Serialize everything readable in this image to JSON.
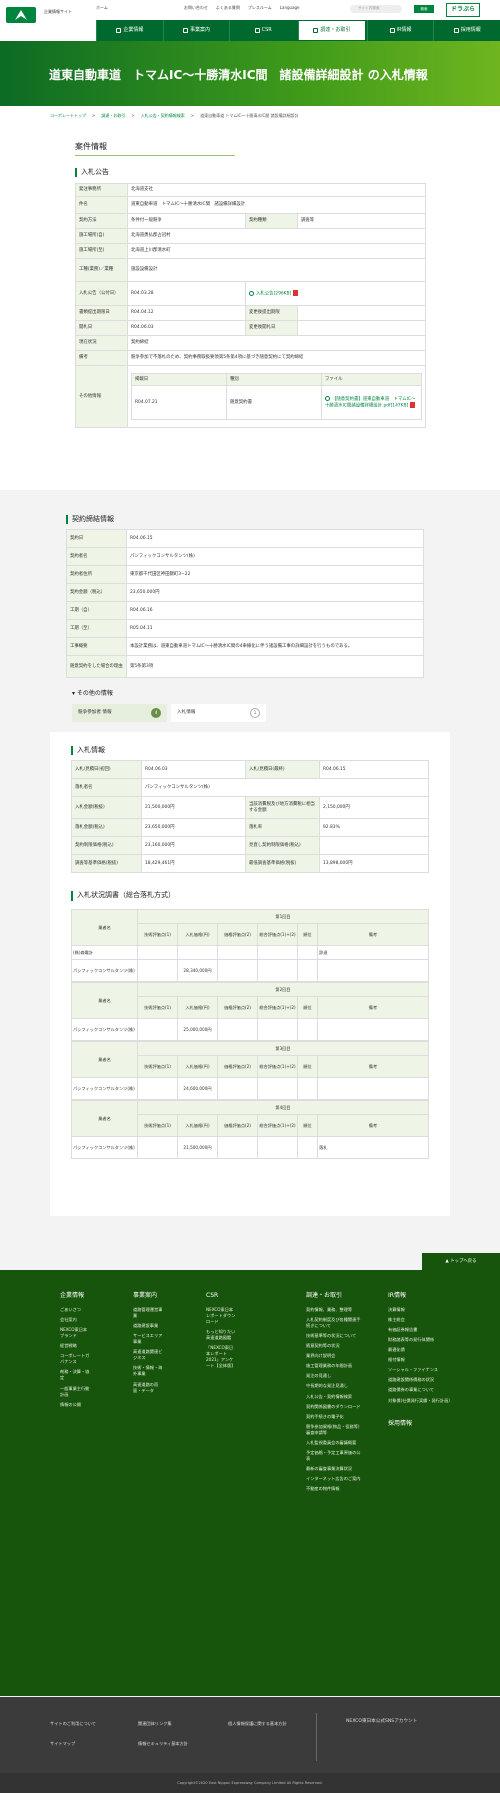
{
  "header": {
    "corp_name": "企業情報サイト",
    "home": "ホーム",
    "contact": "お問い合わせ",
    "faq": "よくある質問",
    "press": "プレスルーム",
    "lang": "Language",
    "search_placeholder": "サイト内検索",
    "search_btn": "検索",
    "drapla": "ドラぷら"
  },
  "nav": [
    "企業情報",
    "事業案内",
    "CSR",
    "調達・お取引",
    "IR情報",
    "採用情報"
  ],
  "title": "道東自動車道　トマムIC〜十勝清水IC間　諸設備詳細設計 の入札情報",
  "breadcrumb": [
    "コーポレートトップ",
    "調達・お取引",
    "入札公告・契約情報検索",
    "道東自動車道 トマムIC〜十勝清水IC間 諸設備詳細設計"
  ],
  "case": {
    "heading": "案件情報",
    "koukoku": "入札公告",
    "rows": [
      [
        "発注事務所",
        "北海道支社"
      ],
      [
        "件名",
        "道東自動車道　トマムIC〜十勝清水IC間　諸設備詳細設計"
      ]
    ],
    "method_l": "契約方法",
    "method": "条件付一般競争",
    "kind_l": "契約種類",
    "kind": "調査等",
    "place1_l": "施工場所(自)",
    "place1": "北海道勇払郡占冠村",
    "place2_l": "施工場所(至)",
    "place2": "北海道上川郡清水町",
    "type_l": "工種(業務)／業種",
    "type": "施設設備設計",
    "date_l": "入札公告（公付日）",
    "date": "R04.03.28",
    "file": "入札公告[296KB]",
    "desk_l": "書類提出期限日",
    "desk": "R04.04.12",
    "chg1_l": "変更後提出期限",
    "chg1": "",
    "open_l": "開札日",
    "open": "R04.06.03",
    "chg2_l": "変更後開札日",
    "chg2": "",
    "status_l": "現在状況",
    "status": "契約締結",
    "note_l": "備考",
    "note": "競争参加で不落札のため、契約事務取扱要領第5条第4項に基づき随意契約にて契約締結",
    "other_l": "その他情報",
    "oh": [
      "掲載日",
      "種別",
      "ファイル"
    ],
    "od": "R04.07.21",
    "ok": "随意契約書",
    "of": "【随意契約書】道東自動車道　トマムIC〜十勝清水IC間諸設備詳細設計.pdf[147KB]"
  },
  "contract": {
    "heading": "契約締結情報",
    "rows": [
      [
        "契約日",
        "R04.06.15"
      ],
      [
        "契約者名",
        "パシフィックコンサルタンツ(株)"
      ],
      [
        "契約者住所",
        "東京都千代田区神田錦町3−22"
      ],
      [
        "契約金額（税込）",
        "23,650,000円"
      ],
      [
        "工期（自）",
        "R04.06.16"
      ],
      [
        "工期（至）",
        "R05.04.11"
      ],
      [
        "工事概要",
        "本設計業務は、道東自動車道トマムIC〜十勝清水IC間の4車線化に伴う諸設備工事の詳細設計を行うものである。"
      ],
      [
        "随意契約をした場合の理由",
        "第5条第3項"
      ]
    ]
  },
  "other": {
    "heading": "その他の情報",
    "tab1": "競争参加者 情報",
    "tab1_n": "4",
    "tab2": "入札情報",
    "tab2_n": "1"
  },
  "bid": {
    "heading": "入札情報",
    "rows": [
      [
        "入札/見積日(初回)",
        "R04.06.03",
        "入札/見積日(最終)",
        "R04.06.15"
      ],
      [
        "落札者名",
        "パシフィックコンサルタンツ(株)",
        "",
        ""
      ],
      [
        "入札金額(税抜)",
        "21,500,000円",
        "当該消費税及び地方消費税に相当する金額",
        "2,150,000円"
      ],
      [
        "落札金額(税込)",
        "23,650,000円",
        "落札率",
        "92.83%"
      ],
      [
        "契約制限価格(税込)",
        "23,160,000円",
        "見直し契約制限価格(税込)",
        ""
      ],
      [
        "調査等基準価格(税抜)",
        "18,429,461円",
        "最低調査基準価格(税抜)",
        "13,898,000円"
      ]
    ]
  },
  "status": {
    "heading": "入札状況調書（総合落札方式）",
    "name_h": "業者名",
    "cols": [
      "技術評価点(1)",
      "入札価格(円)",
      "価格評価点(2)",
      "総合評価点(1)+(2)",
      "順位",
      "備考"
    ],
    "rounds": [
      {
        "label": "第1回目",
        "rows": [
          [
            "(株)森電計",
            "",
            "",
            "",
            "",
            "",
            "辞退"
          ],
          [
            "パシフィックコンサルタンツ(株)",
            "",
            "28,340,000円",
            "",
            "",
            "",
            ""
          ]
        ]
      },
      {
        "label": "第2回目",
        "rows": [
          [
            "パシフィックコンサルタンツ(株)",
            "",
            "25,000,000円",
            "",
            "",
            "",
            ""
          ]
        ]
      },
      {
        "label": "第3回目",
        "rows": [
          [
            "パシフィックコンサルタンツ(株)",
            "",
            "24,600,000円",
            "",
            "",
            "",
            ""
          ]
        ]
      },
      {
        "label": "第4回目",
        "rows": [
          [
            "パシフィックコンサルタンツ(株)",
            "",
            "21,500,000円",
            "",
            "",
            "",
            "落札"
          ]
        ]
      }
    ]
  },
  "totop": "トップへ戻る",
  "footer": {
    "cols": [
      {
        "h": "企業情報",
        "items": [
          "ごあいさつ",
          "会社案内",
          "NEXCO東日本ブランド",
          "経営戦略",
          "コーポレートガバナンス",
          "剤務・決算・協定",
          "一般事業主行動計画",
          "情報の公開"
        ]
      },
      {
        "h": "事業案内",
        "items": [
          "道路管理運営事業",
          "道路建設事業",
          "サービスエリア事業",
          "高速道路関連ビジネス",
          "技術・情報・海外事業",
          "高速道路の而面・データ"
        ]
      },
      {
        "h": "CSR",
        "items": [
          "NEXCO東日本レポートダウンロード",
          "もっと知りたい高速道路図鑑",
          "「NEXCO東日本レポート2021」アンケート【全体版】"
        ]
      },
      {
        "h": "調達・お取引",
        "items": [
          "契約情報、業務、整理等",
          "入札契約制度及び各種関連手続きについて",
          "技術基準等の状況について",
          "随意契約等の状況",
          "業界向け説明会",
          "施工管理業務の年間計画",
          "発注の見通し",
          "中長期的な発注見通し",
          "入札公告・契約情報検索",
          "契約関係図書のダウンロード",
          "契約手続きの電子化",
          "競争参加資格(物品・役務等)審査申請等",
          "入札監視委員会の審議概要",
          "予定価格・予定工事原価の公表",
          "最新の審査事業決算状況",
          "インターネット広告のご案内",
          "不動産の物件情報"
        ]
      },
      {
        "h": "IR情報",
        "items": [
          "決算情報",
          "株主総会",
          "有価証券報告書",
          "財務諸表等の発行体関係",
          "最適化債",
          "格付情報",
          "ソーシャル・ファイナンス",
          "道路建設関係債務の状況",
          "道路債券の事業について",
          "対象債(社債発行実績・発行計画)"
        ]
      },
      {
        "h": "採用情報",
        "items": []
      }
    ]
  },
  "footer2": {
    "l1": "サイトのご利用について",
    "l2": "関連団体リンク集",
    "l3": "個人情報保護に関する基本方針",
    "l4": "サイトマップ",
    "l5": "情報セキュリティ基本方針",
    "sns": "NEXCO東日本公式SNSアカウント"
  },
  "copy": "Copyright©2020 East Nippon Expressway Company Limited All Rights Reserved."
}
